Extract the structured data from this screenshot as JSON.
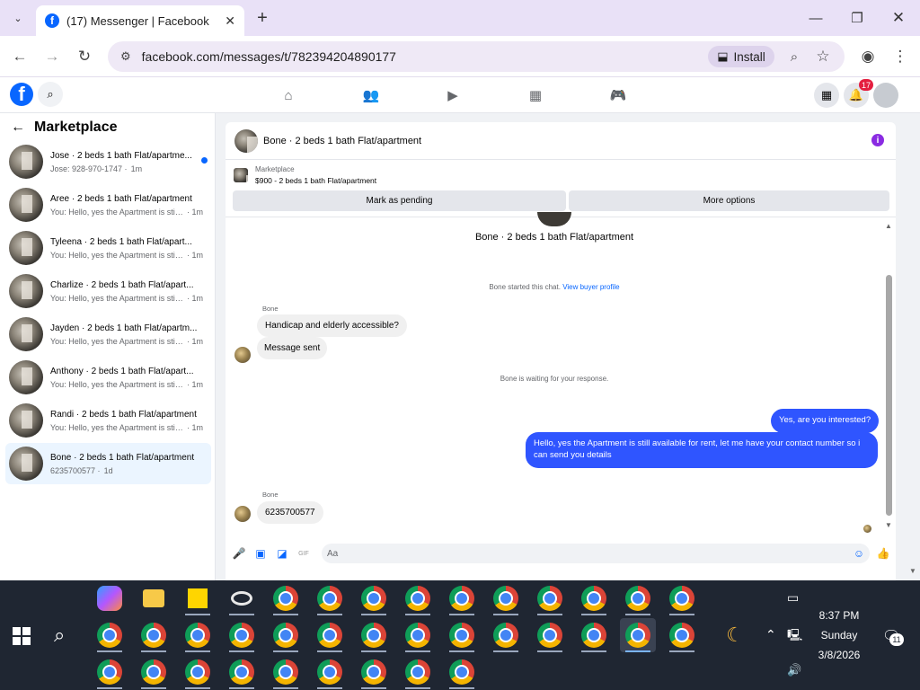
{
  "browser": {
    "tab_title": "(17) Messenger | Facebook",
    "url": "facebook.com/messages/t/782394204890177",
    "install_label": "Install"
  },
  "facebook": {
    "notif_count": "17"
  },
  "sidebar": {
    "title": "Marketplace",
    "conversations": [
      {
        "name": "Jose · 2 beds 1 bath Flat/apartme...",
        "preview": "Jose: 928-970-1747 ·",
        "time": "1m",
        "unread": true
      },
      {
        "name": "Aree · 2 beds 1 bath Flat/apartment",
        "preview": "You: Hello, yes the Apartment is still a...",
        "time": "· 1m"
      },
      {
        "name": "Tyleena · 2 beds 1 bath Flat/apart...",
        "preview": "You: Hello, yes the Apartment is still a...",
        "time": "· 1m"
      },
      {
        "name": "Charlize · 2 beds 1 bath Flat/apart...",
        "preview": "You: Hello, yes the Apartment is still a...",
        "time": "· 1m"
      },
      {
        "name": "Jayden · 2 beds 1 bath Flat/apartm...",
        "preview": "You: Hello, yes the Apartment is still a...",
        "time": "· 1m"
      },
      {
        "name": "Anthony · 2 beds 1 bath Flat/apart...",
        "preview": "You: Hello, yes the Apartment is still a...",
        "time": "· 1m"
      },
      {
        "name": "Randi · 2 beds 1 bath Flat/apartment",
        "preview": "You: Hello, yes the Apartment is still a...",
        "time": "· 1m"
      },
      {
        "name": "Bone · 2 beds 1 bath Flat/apartment",
        "preview": "6235700577 ·",
        "time": "1d",
        "selected": true
      }
    ]
  },
  "chat": {
    "header_name": "Bone · 2 beds 1 bath Flat/apartment",
    "marketplace_label": "Marketplace",
    "listing": "$900 - 2 beds 1 bath Flat/apartment",
    "mark_pending": "Mark as pending",
    "more_options": "More options",
    "top_name": "Bone · 2 beds 1 bath Flat/apartment",
    "started_text": "Bone started this chat.",
    "view_profile": "View buyer profile",
    "sender1": "Bone",
    "msg1": "Handicap and elderly accessible?",
    "msg2": "Message sent",
    "waiting": "Bone is waiting for your response.",
    "out1": "Yes, are you interested?",
    "out2": "Hello, yes the Apartment is still available for rent, let me have your contact number so i can send you details",
    "sender2": "Bone",
    "msg3": "6235700577",
    "input_placeholder": "Aa"
  },
  "taskbar": {
    "time": "8:37 PM",
    "day": "Sunday",
    "date": "3/8/2026",
    "notif": "11"
  }
}
